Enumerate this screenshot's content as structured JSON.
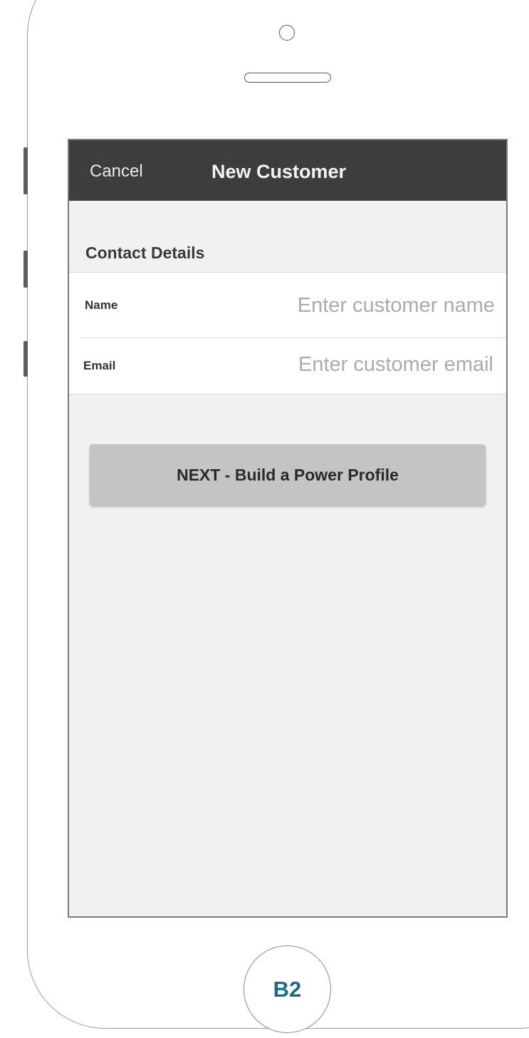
{
  "nav": {
    "cancel_label": "Cancel",
    "title": "New Customer"
  },
  "section": {
    "title": "Contact Details"
  },
  "form": {
    "name": {
      "label": "Name",
      "value": "",
      "placeholder": "Enter customer name"
    },
    "email": {
      "label": "Email",
      "value": "",
      "placeholder": "Enter customer email"
    }
  },
  "actions": {
    "next_label": "NEXT - Build a Power Profile"
  },
  "device": {
    "home_label": "B2"
  },
  "colors": {
    "nav_background": "#3d3d3d",
    "screen_background": "#f1f1f1",
    "button_background": "#c4c4c4",
    "home_label": "#1e6a8a"
  }
}
